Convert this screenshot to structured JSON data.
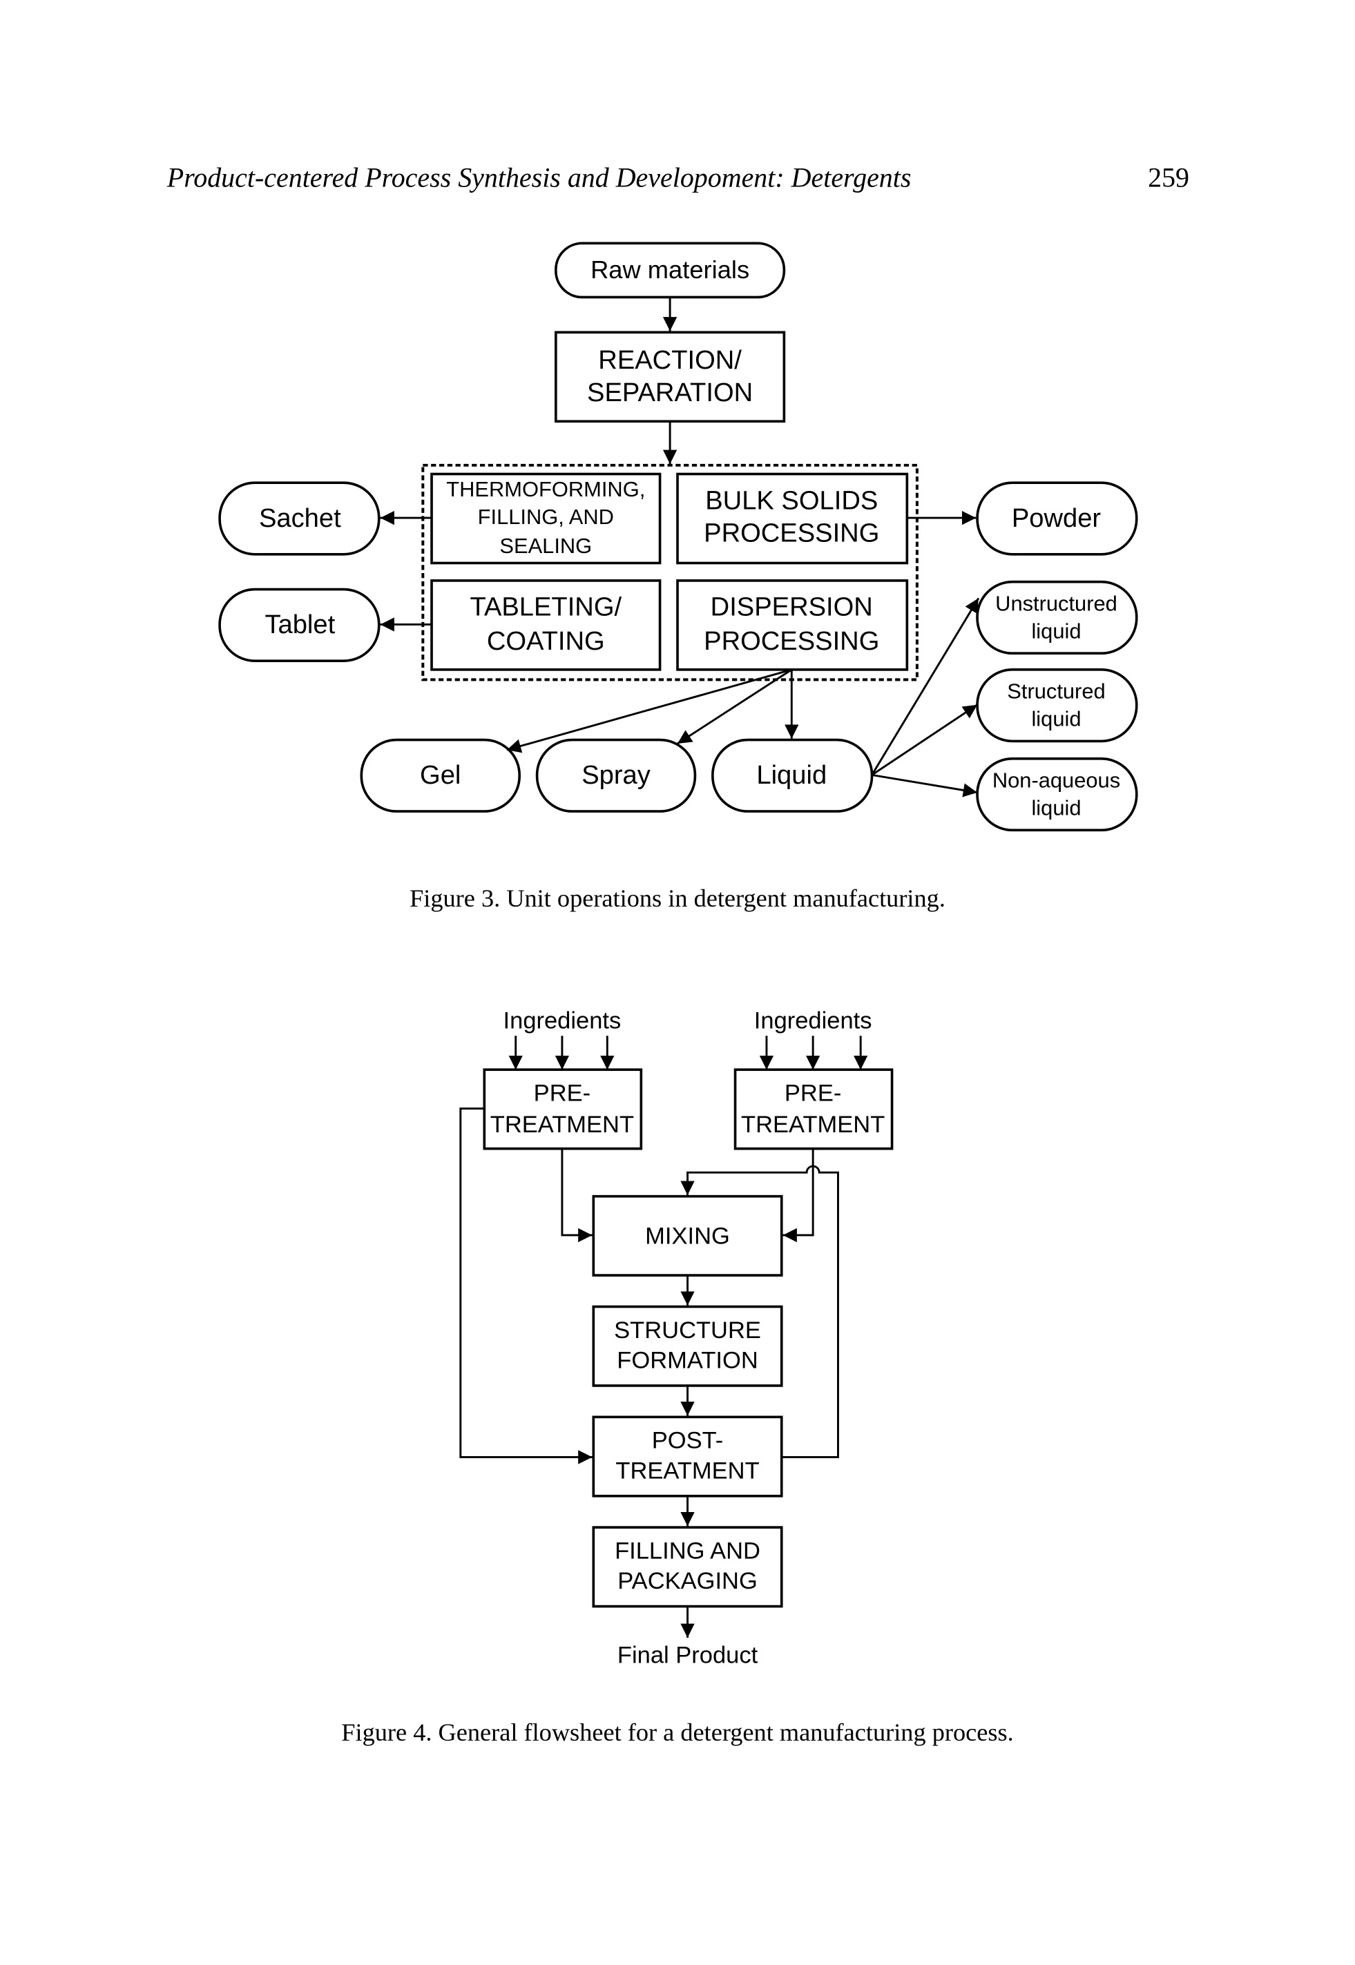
{
  "header": {
    "running_title": "Product-centered Process Synthesis and Developoment: Detergents",
    "page_number": "259"
  },
  "figure3": {
    "nodes": {
      "raw_materials": "Raw materials",
      "reaction_l1": "REACTION/",
      "reaction_l2": "SEPARATION",
      "thermo_l1": "THERMOFORMING,",
      "thermo_l2": "FILLING, AND",
      "thermo_l3": "SEALING",
      "bulk_l1": "BULK SOLIDS",
      "bulk_l2": "PROCESSING",
      "tablet_op_l1": "TABLETING/",
      "tablet_op_l2": "COATING",
      "disp_l1": "DISPERSION",
      "disp_l2": "PROCESSING",
      "sachet": "Sachet",
      "tablet": "Tablet",
      "powder": "Powder",
      "gel": "Gel",
      "spray": "Spray",
      "liquid": "Liquid",
      "unstructured_l1": "Unstructured",
      "unstructured_l2": "liquid",
      "structured_l1": "Structured",
      "structured_l2": "liquid",
      "nonaqueous_l1": "Non-aqueous",
      "nonaqueous_l2": "liquid"
    },
    "caption": "Figure 3. Unit operations in detergent manufacturing."
  },
  "figure4": {
    "nodes": {
      "ingredients_left": "Ingredients",
      "ingredients_right": "Ingredients",
      "pre_left_l1": "PRE-",
      "pre_left_l2": "TREATMENT",
      "pre_right_l1": "PRE-",
      "pre_right_l2": "TREATMENT",
      "mixing": "MIXING",
      "structure_l1": "STRUCTURE",
      "structure_l2": "FORMATION",
      "post_l1": "POST-",
      "post_l2": "TREATMENT",
      "filling_l1": "FILLING AND",
      "filling_l2": "PACKAGING",
      "final_product": "Final Product"
    },
    "caption": "Figure 4.  General flowsheet for a detergent manufacturing process."
  }
}
